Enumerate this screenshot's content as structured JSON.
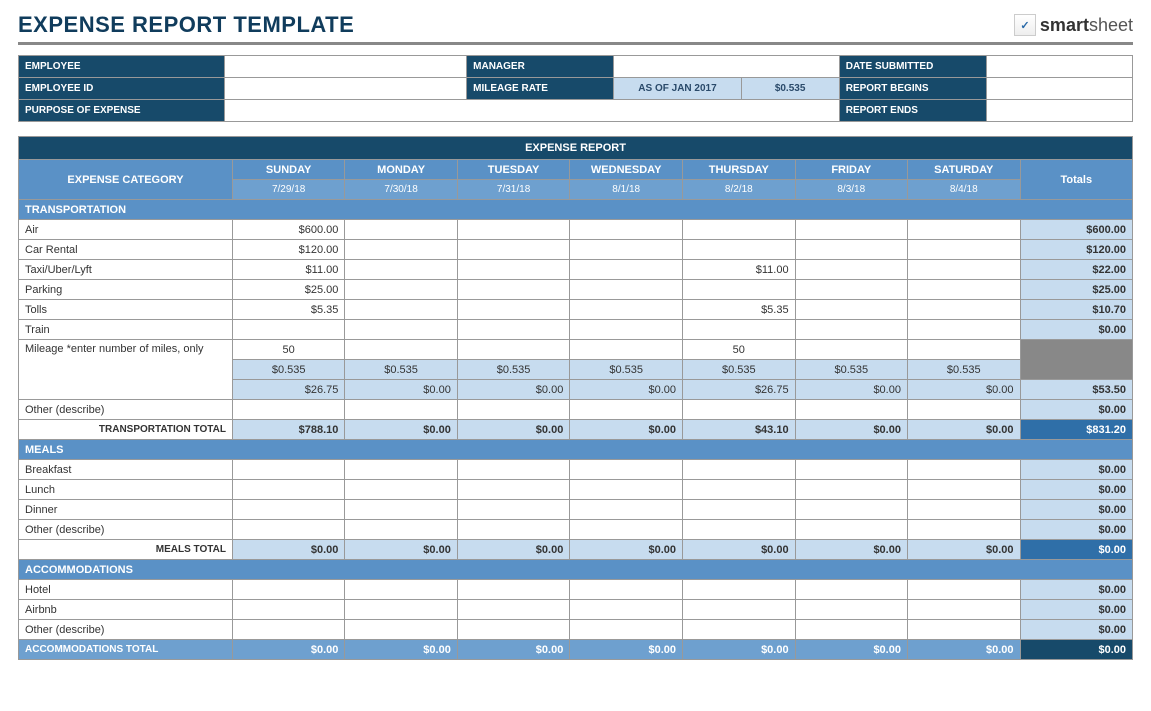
{
  "title": "EXPENSE REPORT TEMPLATE",
  "brand": "smartsheet",
  "info": {
    "employee_lbl": "EMPLOYEE",
    "employee_id_lbl": "EMPLOYEE ID",
    "purpose_lbl": "PURPOSE OF EXPENSE",
    "manager_lbl": "MANAGER",
    "mileage_rate_lbl": "MILEAGE RATE",
    "mileage_asof": "AS OF JAN 2017",
    "mileage_rate": "$0.535",
    "date_submitted_lbl": "DATE SUBMITTED",
    "report_begins_lbl": "REPORT BEGINS",
    "report_ends_lbl": "REPORT ENDS"
  },
  "table": {
    "report_hdr": "EXPENSE REPORT",
    "cat_hdr": "EXPENSE CATEGORY",
    "totals_hdr": "Totals",
    "days": [
      "SUNDAY",
      "MONDAY",
      "TUESDAY",
      "WEDNESDAY",
      "THURSDAY",
      "FRIDAY",
      "SATURDAY"
    ],
    "dates": [
      "7/29/18",
      "7/30/18",
      "7/31/18",
      "8/1/18",
      "8/2/18",
      "8/3/18",
      "8/4/18"
    ],
    "sections": [
      {
        "name": "TRANSPORTATION",
        "rows": [
          {
            "label": "Air",
            "vals": [
              "$600.00",
              "",
              "",
              "",
              "",
              "",
              ""
            ],
            "total": "$600.00"
          },
          {
            "label": "Car Rental",
            "vals": [
              "$120.00",
              "",
              "",
              "",
              "",
              "",
              ""
            ],
            "total": "$120.00"
          },
          {
            "label": "Taxi/Uber/Lyft",
            "vals": [
              "$11.00",
              "",
              "",
              "",
              "$11.00",
              "",
              ""
            ],
            "total": "$22.00"
          },
          {
            "label": "Parking",
            "vals": [
              "$25.00",
              "",
              "",
              "",
              "",
              "",
              ""
            ],
            "total": "$25.00"
          },
          {
            "label": "Tolls",
            "vals": [
              "$5.35",
              "",
              "",
              "",
              "$5.35",
              "",
              ""
            ],
            "total": "$10.70"
          },
          {
            "label": "Train",
            "vals": [
              "",
              "",
              "",
              "",
              "",
              "",
              ""
            ],
            "total": "$0.00"
          }
        ],
        "mileage_label": "Mileage *enter number of miles, only",
        "mileage_miles": [
          "50",
          "",
          "",
          "",
          "50",
          "",
          ""
        ],
        "mileage_rate": [
          "$0.535",
          "$0.535",
          "$0.535",
          "$0.535",
          "$0.535",
          "$0.535",
          "$0.535"
        ],
        "mileage_calc": [
          "$26.75",
          "$0.00",
          "$0.00",
          "$0.00",
          "$26.75",
          "$0.00",
          "$0.00"
        ],
        "mileage_total": "$53.50",
        "other_label": "Other (describe)",
        "other_total": "$0.00",
        "subtotal_label": "TRANSPORTATION TOTAL",
        "subtotal": [
          "$788.10",
          "$0.00",
          "$0.00",
          "$0.00",
          "$43.10",
          "$0.00",
          "$0.00"
        ],
        "subtotal_final": "$831.20"
      },
      {
        "name": "MEALS",
        "rows": [
          {
            "label": "Breakfast",
            "vals": [
              "",
              "",
              "",
              "",
              "",
              "",
              ""
            ],
            "total": "$0.00"
          },
          {
            "label": "Lunch",
            "vals": [
              "",
              "",
              "",
              "",
              "",
              "",
              ""
            ],
            "total": "$0.00"
          },
          {
            "label": "Dinner",
            "vals": [
              "",
              "",
              "",
              "",
              "",
              "",
              ""
            ],
            "total": "$0.00"
          },
          {
            "label": "Other (describe)",
            "vals": [
              "",
              "",
              "",
              "",
              "",
              "",
              ""
            ],
            "total": "$0.00"
          }
        ],
        "subtotal_label": "MEALS TOTAL",
        "subtotal": [
          "$0.00",
          "$0.00",
          "$0.00",
          "$0.00",
          "$0.00",
          "$0.00",
          "$0.00"
        ],
        "subtotal_final": "$0.00"
      },
      {
        "name": "ACCOMMODATIONS",
        "rows": [
          {
            "label": "Hotel",
            "vals": [
              "",
              "",
              "",
              "",
              "",
              "",
              ""
            ],
            "total": "$0.00"
          },
          {
            "label": "Airbnb",
            "vals": [
              "",
              "",
              "",
              "",
              "",
              "",
              ""
            ],
            "total": "$0.00"
          },
          {
            "label": "Other (describe)",
            "vals": [
              "",
              "",
              "",
              "",
              "",
              "",
              ""
            ],
            "total": "$0.00"
          }
        ],
        "subtotal_label": "ACCOMMODATIONS TOTAL",
        "subtotal": [
          "$0.00",
          "$0.00",
          "$0.00",
          "$0.00",
          "$0.00",
          "$0.00",
          "$0.00"
        ],
        "subtotal_final": "$0.00"
      }
    ]
  }
}
